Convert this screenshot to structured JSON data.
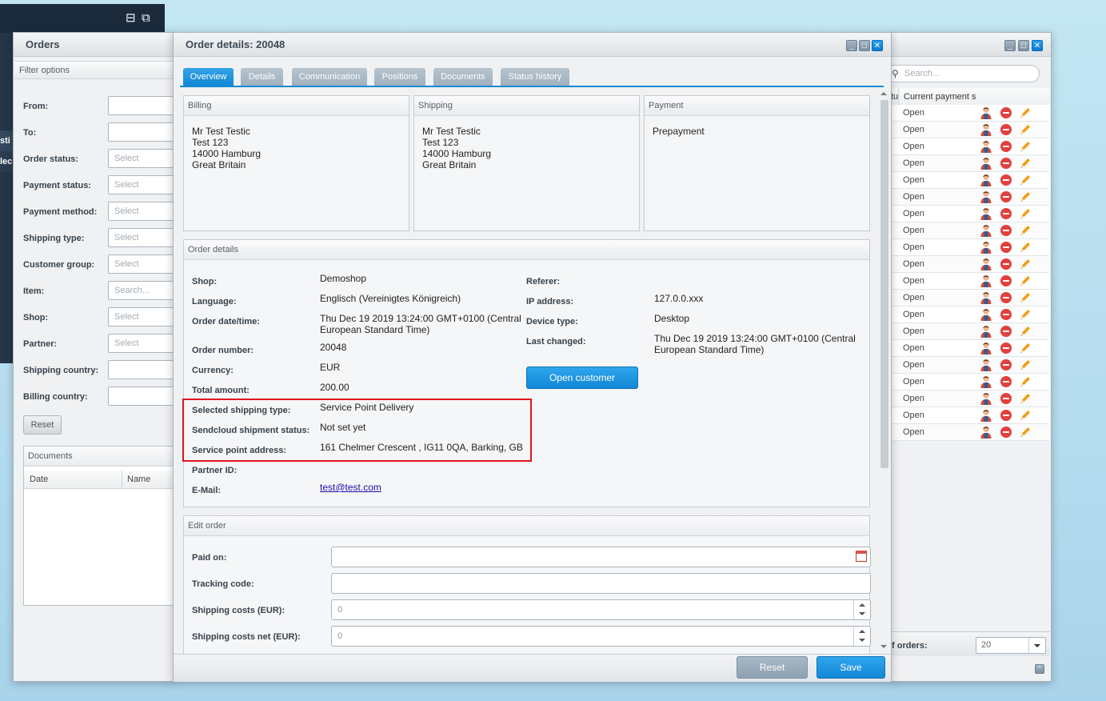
{
  "orders_window": {
    "title": "Orders",
    "filter_header": "Filter options",
    "filters": [
      {
        "label": "From:",
        "value": ""
      },
      {
        "label": "To:",
        "value": ""
      },
      {
        "label": "Order status:",
        "value": "Select"
      },
      {
        "label": "Payment status:",
        "value": "Select"
      },
      {
        "label": "Payment method:",
        "value": "Select"
      },
      {
        "label": "Shipping type:",
        "value": "Select"
      },
      {
        "label": "Customer group:",
        "value": "Select"
      },
      {
        "label": "Item:",
        "value": "Search..."
      },
      {
        "label": "Shop:",
        "value": "Select"
      },
      {
        "label": "Partner:",
        "value": "Select"
      },
      {
        "label": "Shipping country:",
        "value": ""
      },
      {
        "label": "Billing country:",
        "value": ""
      }
    ],
    "reset_label": "Reset",
    "documents_header": "Documents",
    "documents_columns": [
      "Date",
      "Name"
    ]
  },
  "sidebar": {
    "bands": [
      "sti",
      "lec"
    ]
  },
  "detail_window": {
    "title": "Order details: 20048",
    "tabs": [
      "Overview",
      "Details",
      "Communication",
      "Positions",
      "Documents",
      "Status history"
    ],
    "billing": {
      "header": "Billing",
      "lines": [
        "Mr Test Testic",
        "Test 123",
        "14000 Hamburg",
        "Great Britain"
      ]
    },
    "shipping": {
      "header": "Shipping",
      "lines": [
        "Mr Test Testic",
        "Test 123",
        "14000 Hamburg",
        "Great Britain"
      ]
    },
    "payment": {
      "header": "Payment",
      "value": "Prepayment"
    },
    "order_details": {
      "header": "Order details",
      "shop": {
        "label": "Shop:",
        "value": "Demoshop"
      },
      "language": {
        "label": "Language:",
        "value": "Englisch (Vereinigtes Königreich)"
      },
      "order_datetime": {
        "label": "Order date/time:",
        "value": "Thu Dec 19 2019 13:24:00 GMT+0100 (Central European Standard Time)"
      },
      "order_number": {
        "label": "Order number:",
        "value": "20048"
      },
      "currency": {
        "label": "Currency:",
        "value": "EUR"
      },
      "total_amount": {
        "label": "Total amount:",
        "value": "200.00"
      },
      "selected_shipping_type": {
        "label": "Selected shipping type:",
        "value": "Service Point Delivery"
      },
      "sendcloud_status": {
        "label": "Sendcloud shipment status:",
        "value": "Not set yet"
      },
      "service_point_address": {
        "label": "Service point address:",
        "value": "161 Chelmer Crescent , IG11 0QA, Barking, GB"
      },
      "partner_id": {
        "label": "Partner ID:",
        "value": ""
      },
      "email": {
        "label": "E-Mail:",
        "value": "test@test.com"
      },
      "referer": {
        "label": "Referer:",
        "value": ""
      },
      "ip_address": {
        "label": "IP address:",
        "value": "127.0.0.xxx"
      },
      "device_type": {
        "label": "Device type:",
        "value": "Desktop"
      },
      "last_changed": {
        "label": "Last changed:",
        "value": "Thu Dec 19 2019 13:24:00 GMT+0100 (Central European Standard Time)"
      },
      "open_customer_label": "Open customer"
    },
    "edit_order": {
      "header": "Edit order",
      "paid_on": {
        "label": "Paid on:",
        "value": ""
      },
      "tracking_code": {
        "label": "Tracking code:",
        "value": ""
      },
      "shipping_costs": {
        "label": "Shipping costs (EUR):",
        "value": "0"
      },
      "shipping_costs_net": {
        "label": "Shipping costs net (EUR):",
        "value": "0"
      }
    },
    "reset_label": "Reset",
    "save_label": "Save"
  },
  "right_window": {
    "search_placeholder": "Search...",
    "col_prefix": "tu",
    "col_header": "Current payment s",
    "rows": [
      "Open",
      "Open",
      "Open",
      "Open",
      "Open",
      "Open",
      "Open",
      "Open",
      "Open",
      "Open",
      "Open",
      "Open",
      "Open",
      "Open",
      "Open",
      "Open",
      "Open",
      "Open",
      "Open",
      "Open"
    ],
    "orders_label": "f orders:",
    "per_page": "20"
  },
  "colors": {
    "accent": "#1a8fdc",
    "highlight_box": "#e0161c",
    "delete": "#e2403d"
  }
}
